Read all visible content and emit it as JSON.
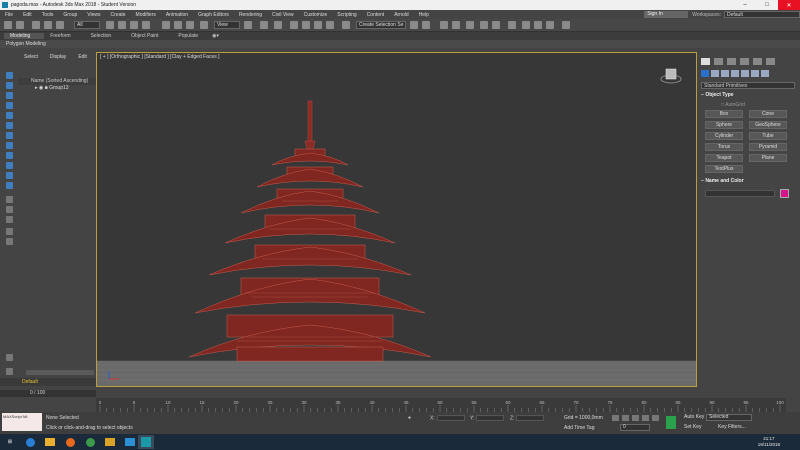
{
  "window": {
    "title": "pagoda.max - Autodesk 3ds Max 2018 - Student Version"
  },
  "menu": [
    "File",
    "Edit",
    "Tools",
    "Group",
    "Views",
    "Create",
    "Modifiers",
    "Animation",
    "Graph Editors",
    "Rendering",
    "Civil View",
    "Customize",
    "Scripting",
    "Content",
    "Arnold",
    "Help"
  ],
  "account": {
    "signin_label": "Sign In",
    "workspaces_label": "Workspaces:",
    "workspace_value": "Default"
  },
  "toolbar": {
    "filter_value": "All",
    "refcoord_value": "View",
    "selection_set_placeholder": "Create Selection Se"
  },
  "ribbon": {
    "tabs": [
      "Modeling",
      "Freeform",
      "Selection",
      "Object Paint",
      "Populate"
    ],
    "active_panel": "Polygon Modeling"
  },
  "explorer": {
    "tabs": [
      "Select",
      "Display",
      "Edit"
    ],
    "column_header": "Name (Sorted Ascending)",
    "rows": [
      "Group13"
    ],
    "layer": "Default",
    "frame_counter": "0 / 100"
  },
  "viewport": {
    "label": "[ + ] [Orthographic ] [Standard ] [Clay + Edged Faces ]"
  },
  "command_panel": {
    "dropdown_value": "Standard Primitives",
    "object_type_title": "Object Type",
    "autogrid_label": "AutoGrid",
    "object_buttons": [
      "Box",
      "Cone",
      "Sphere",
      "GeoSphere",
      "Cylinder",
      "Tube",
      "Torus",
      "Pyramid",
      "Teapot",
      "Plane",
      "TextPlus"
    ],
    "name_color_title": "Name and Color",
    "object_color": "#d6148c"
  },
  "timeline": {
    "ticks": [
      "0",
      "5",
      "10",
      "15",
      "20",
      "25",
      "30",
      "35",
      "40",
      "45",
      "50",
      "55",
      "60",
      "65",
      "70",
      "75",
      "80",
      "85",
      "90",
      "95",
      "100"
    ]
  },
  "status": {
    "maxscript_label": "MAXScript Mi:",
    "selection_text": "None Selected",
    "prompt_text": "Click or click-and-drag to select objects",
    "x_label": "X:",
    "y_label": "Y:",
    "z_label": "Z:",
    "grid_text": "Grid = 1000,0mm",
    "add_time_tag": "Add Time Tag",
    "auto_key": "Auto Key",
    "set_key": "Set Key",
    "selected_value": "Selected",
    "key_filters": "Key Filters...",
    "frame_value": "0"
  },
  "taskbar": {
    "time": "21:17",
    "date": "19/11/2018"
  }
}
